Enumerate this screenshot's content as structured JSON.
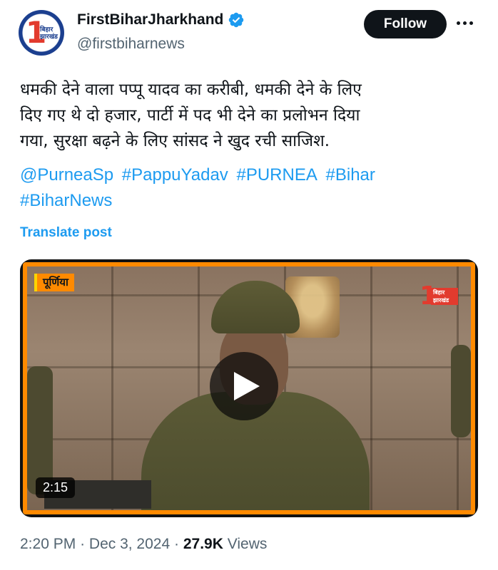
{
  "author": {
    "display_name": "FirstBiharJharkhand",
    "handle": "@firstbiharnews",
    "avatar_logo_text": "बिहार झारखंड"
  },
  "actions": {
    "follow_label": "Follow",
    "more_icon": "more-horizontal-icon"
  },
  "post": {
    "text_lines": [
      "धमकी देने वाला पप्पू यादव का करीबी, धमकी देने के लिए",
      "दिए गए थे दो हजार, पार्टी में पद भी देने का प्रलोभन दिया",
      "गया, सुरक्षा बढ़ने के लिए सांसद ने खुद रची साजिश."
    ],
    "tags": [
      "@PurneaSp",
      "#PappuYadav",
      "#PURNEA",
      "#Bihar",
      "#BiharNews"
    ],
    "translate_label": "Translate post"
  },
  "video": {
    "location_label": "पूर्णिया",
    "duration": "2:15",
    "play_icon": "play-icon",
    "channel_logo_text": "बिहार झारखंड"
  },
  "meta": {
    "time": "2:20 PM",
    "separator": "·",
    "date": "Dec 3, 2024",
    "views_count": "27.9K",
    "views_label": "Views"
  },
  "colors": {
    "link": "#1d9bf0",
    "text": "#0f1419",
    "secondary": "#536471",
    "video_border": "#ff8a00",
    "verified": "#1d9bf0"
  }
}
